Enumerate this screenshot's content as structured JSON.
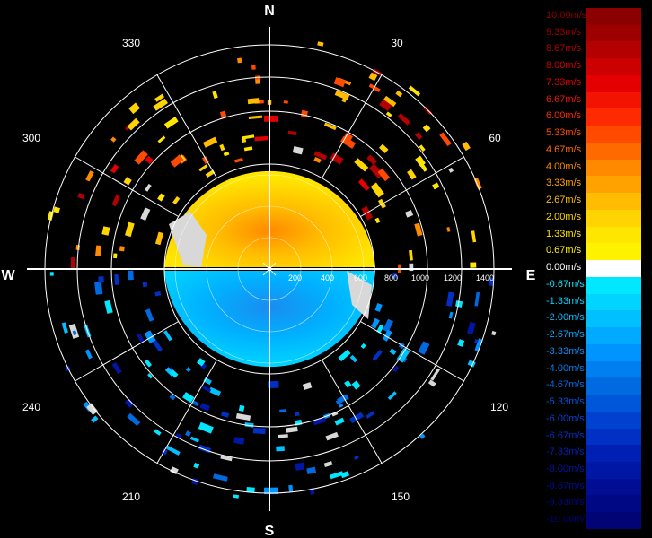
{
  "cardinals": {
    "n": "N",
    "e": "E",
    "s": "S",
    "w": "W"
  },
  "angles": [
    "30",
    "60",
    "120",
    "150",
    "210",
    "240",
    "300",
    "330"
  ],
  "ranges": [
    "200",
    "400",
    "600",
    "800",
    "1000",
    "1200",
    "1400"
  ],
  "legend": [
    {
      "label": "10.00m/s",
      "color": "#8b0000"
    },
    {
      "label": "9.33m/s",
      "color": "#9e0000"
    },
    {
      "label": "8.67m/s",
      "color": "#b40000"
    },
    {
      "label": "8.00m/s",
      "color": "#cc0000"
    },
    {
      "label": "7.33m/s",
      "color": "#e40000"
    },
    {
      "label": "6.67m/s",
      "color": "#f21400"
    },
    {
      "label": "6.00m/s",
      "color": "#ff2a00"
    },
    {
      "label": "5.33m/s",
      "color": "#ff4a00"
    },
    {
      "label": "4.67m/s",
      "color": "#ff6a00"
    },
    {
      "label": "4.00m/s",
      "color": "#ff8a00"
    },
    {
      "label": "3.33m/s",
      "color": "#ffa200"
    },
    {
      "label": "2.67m/s",
      "color": "#ffbc00"
    },
    {
      "label": "2.00m/s",
      "color": "#ffd400"
    },
    {
      "label": "1.33m/s",
      "color": "#ffe600"
    },
    {
      "label": "0.67m/s",
      "color": "#fff200"
    },
    {
      "label": "0.00m/s",
      "color": "#ffffff"
    },
    {
      "label": "-0.67m/s",
      "color": "#00e8ff"
    },
    {
      "label": "-1.33m/s",
      "color": "#00d4ff"
    },
    {
      "label": "-2.00m/s",
      "color": "#00c0ff"
    },
    {
      "label": "-2.67m/s",
      "color": "#00aaff"
    },
    {
      "label": "-3.33m/s",
      "color": "#0094ff"
    },
    {
      "label": "-4.00m/s",
      "color": "#0080f0"
    },
    {
      "label": "-4.67m/s",
      "color": "#006ae0"
    },
    {
      "label": "-5.33m/s",
      "color": "#0056d8"
    },
    {
      "label": "-6.00m/s",
      "color": "#0042d0"
    },
    {
      "label": "-6.67m/s",
      "color": "#0030c4"
    },
    {
      "label": "-7.33m/s",
      "color": "#0020b4"
    },
    {
      "label": "-8.00m/s",
      "color": "#0016a4"
    },
    {
      "label": "-8.67m/s",
      "color": "#000e94"
    },
    {
      "label": "-9.33m/s",
      "color": "#000884"
    },
    {
      "label": "-10.00m/s",
      "color": "#000474"
    }
  ]
}
